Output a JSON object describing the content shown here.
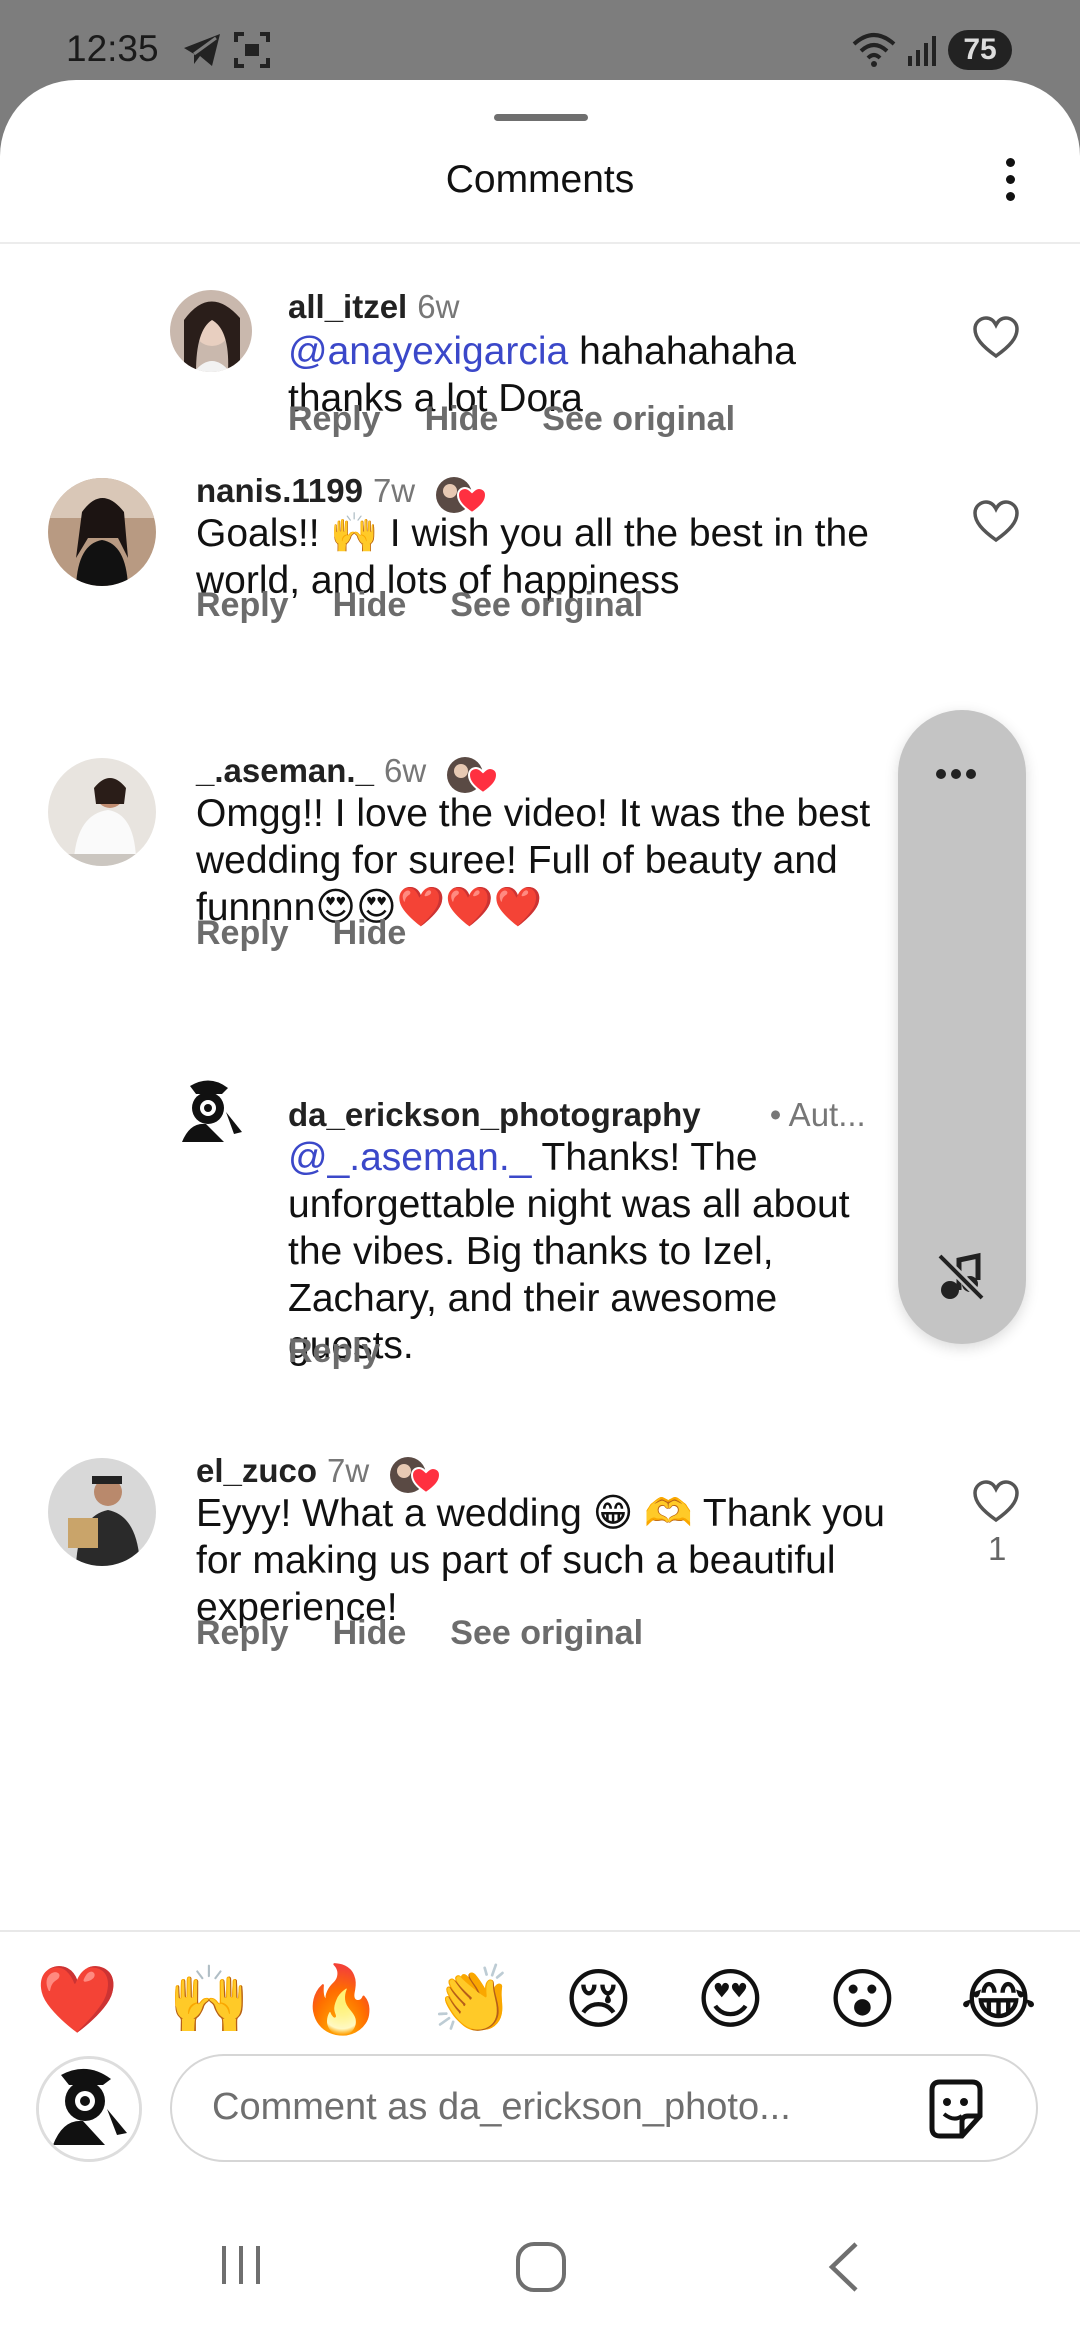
{
  "status_bar": {
    "time": "12:35",
    "battery": "75"
  },
  "sheet": {
    "title": "Comments"
  },
  "comments": [
    {
      "username": "all_itzel",
      "time": "6w",
      "mention": "@anayexigarcia",
      "text": " hahahahaha thanks a lot Dora",
      "actions": [
        "Reply",
        "Hide",
        "See original"
      ]
    },
    {
      "username": "nanis.1199",
      "time": "7w",
      "text": "Goals!! 🙌 I wish you all the best in the world, and lots of happiness",
      "actions": [
        "Reply",
        "Hide",
        "See original"
      ]
    },
    {
      "username": "_.aseman._",
      "time": "6w",
      "text": "Omgg!! I love the video! It was the best wedding for suree! Full of beauty and funnnn😍😍❤️❤️❤️",
      "actions": [
        "Reply",
        "Hide"
      ]
    },
    {
      "username": "da_erickson_photography",
      "badge": "• Aut...",
      "mention": "@_.aseman._",
      "text": " Thanks! The unforgettable night was all about the vibes. Big thanks to Izel, Zachary, and their awesome guests.",
      "actions": [
        "Reply"
      ]
    },
    {
      "username": "el_zuco",
      "time": "7w",
      "text": "Eyyy! What a wedding 😁 🫶 Thank you for making us part of such a beautiful experience!",
      "actions": [
        "Reply",
        "Hide",
        "See original"
      ],
      "likes": "1"
    }
  ],
  "emoji_bar": [
    "❤️",
    "🙌",
    "🔥",
    "👏",
    "😢",
    "😍",
    "😮",
    "😂"
  ],
  "composer": {
    "placeholder": "Comment as da_erickson_photo..."
  },
  "colors": {
    "mention": "#3b48c9",
    "heart_red": "#ff3040",
    "pill": "#c4c4c4"
  }
}
